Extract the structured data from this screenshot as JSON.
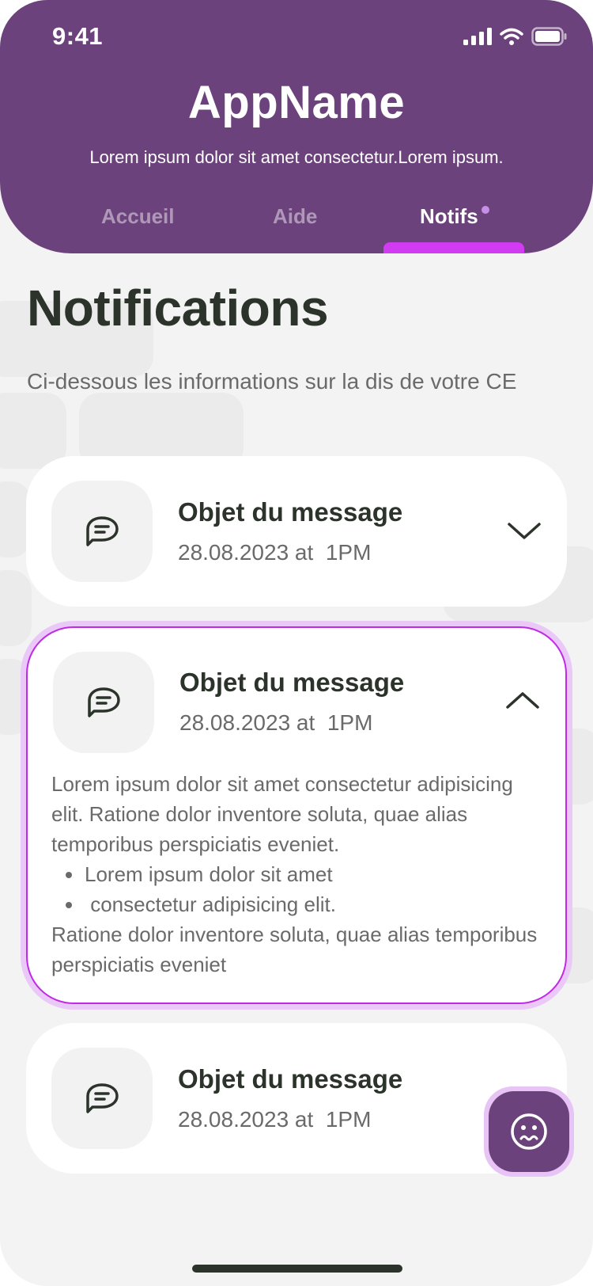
{
  "status_bar": {
    "time": "9:41"
  },
  "header": {
    "app_name": "AppName",
    "subtitle": "Lorem ipsum dolor sit amet consectetur.Lorem ipsum."
  },
  "tabs": [
    {
      "label": "Accueil",
      "active": false
    },
    {
      "label": "Aide",
      "active": false
    },
    {
      "label": "Notifs",
      "active": true,
      "has_badge": true
    }
  ],
  "page": {
    "title": "Notifications",
    "description": "Ci-dessous les informations sur la dis de votre CE"
  },
  "notifications": [
    {
      "icon": "message-icon",
      "title": "Objet du message",
      "date": "28.08.2023 at  1PM",
      "expanded": false
    },
    {
      "icon": "message-icon",
      "title": "Objet du message",
      "date": "28.08.2023 at  1PM",
      "expanded": true,
      "body": {
        "intro": "Lorem ipsum dolor sit amet consectetur adipisicing elit. Ratione dolor inventore soluta, quae alias temporibus perspiciatis eveniet.",
        "bullets": [
          "Lorem ipsum dolor sit amet",
          " consectetur adipisicing elit."
        ],
        "outro": "Ratione dolor inventore soluta, quae alias temporibus perspiciatis eveniet"
      }
    },
    {
      "icon": "message-icon",
      "title": "Objet du message",
      "date": "28.08.2023 at  1PM",
      "expanded": false
    }
  ],
  "fab": {
    "icon": "face-icon"
  },
  "colors": {
    "primary": "#6c427c",
    "accent": "#d13cf2",
    "text_dark": "#2b332b",
    "text_muted": "#6a6a6a",
    "background": "#f3f3f3"
  }
}
